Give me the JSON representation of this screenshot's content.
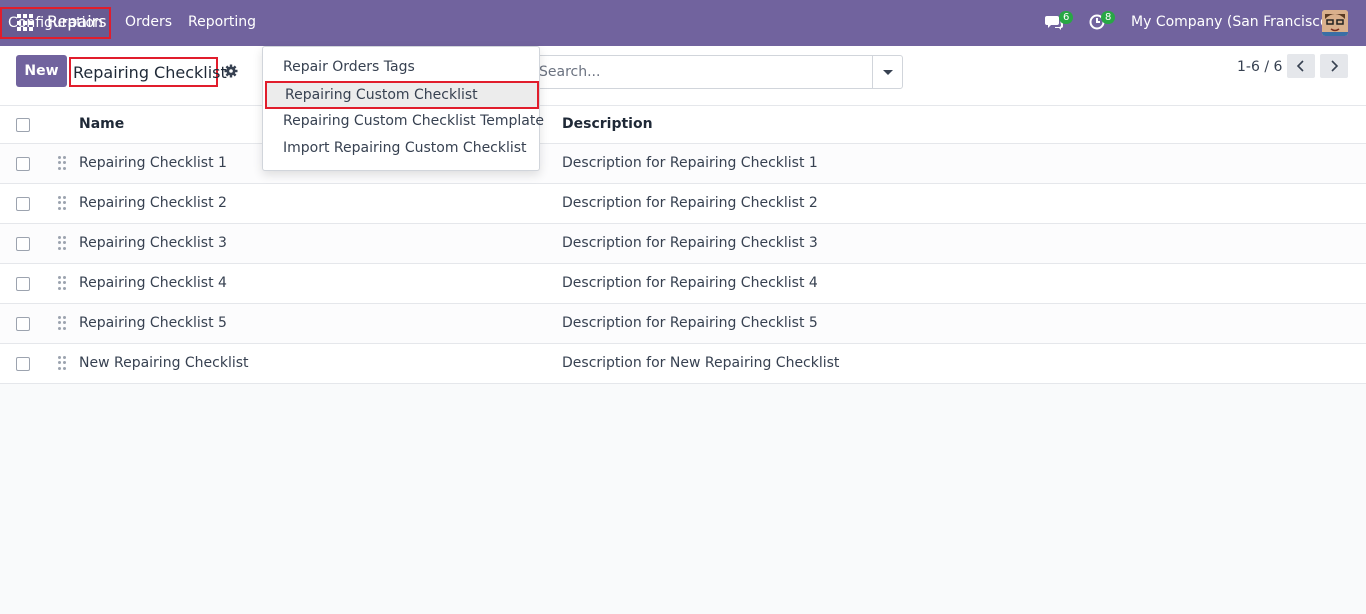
{
  "navbar": {
    "brand": "Repairs",
    "menu": {
      "orders": "Orders",
      "reporting": "Reporting",
      "configuration": "Configuration"
    },
    "messages_badge": "6",
    "activities_badge": "8",
    "company": "My Company (San Francisco)",
    "accent_color": "#71639e"
  },
  "control_panel": {
    "new_button": "New",
    "title": "Repairing Checklist",
    "search_placeholder": "Search...",
    "pager": "1-6 / 6"
  },
  "dropdown": {
    "items": [
      "Repair Orders Tags",
      "Repairing Custom Checklist",
      "Repairing Custom Checklist Template",
      "Import Repairing Custom Checklist"
    ],
    "highlighted_index": 1
  },
  "list": {
    "columns": [
      "Name",
      "Description"
    ],
    "rows": [
      {
        "name": "Repairing Checklist 1",
        "description": "Description for Repairing Checklist 1"
      },
      {
        "name": "Repairing Checklist 2",
        "description": "Description for Repairing Checklist 2"
      },
      {
        "name": "Repairing Checklist 3",
        "description": "Description for Repairing Checklist 3"
      },
      {
        "name": "Repairing Checklist 4",
        "description": "Description for Repairing Checklist 4"
      },
      {
        "name": "Repairing Checklist 5",
        "description": "Description for Repairing Checklist 5"
      },
      {
        "name": "New Repairing Checklist",
        "description": "Description for New Repairing Checklist"
      }
    ]
  },
  "icons": {
    "apps": "apps-grid-icon",
    "chat": "chat-icon",
    "activity": "clock-icon",
    "gear": "gear-icon",
    "caret": "caret-down-icon",
    "handle": "drag-handle-icon"
  }
}
